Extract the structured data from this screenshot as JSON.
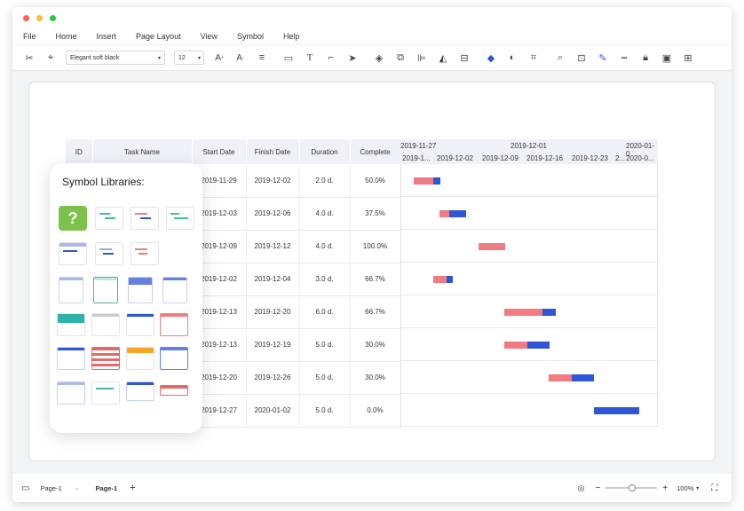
{
  "menu": [
    "File",
    "Home",
    "Insert",
    "Page Layout",
    "View",
    "Symbol",
    "Help"
  ],
  "toolbar": {
    "font_name": "Elegant soft black",
    "font_size": "12"
  },
  "table": {
    "headers": [
      "ID",
      "Task Name",
      "Start Date",
      "Finish Date",
      "Duration",
      "Complete"
    ],
    "rows": [
      {
        "start": "2019-11-29",
        "finish": "2019-12-02",
        "duration": "2.0 d.",
        "complete": "50.0%"
      },
      {
        "start": "2019-12-03",
        "finish": "2019-12-06",
        "duration": "4.0 d.",
        "complete": "37.5%"
      },
      {
        "start": "2019-12-09",
        "finish": "2019-12-12",
        "duration": "4.0 d.",
        "complete": "100.0%"
      },
      {
        "start": "2019-12-02",
        "finish": "2019-12-04",
        "duration": "3.0 d.",
        "complete": "66.7%"
      },
      {
        "start": "2019-12-13",
        "finish": "2019-12-20",
        "duration": "6.0 d.",
        "complete": "66.7%"
      },
      {
        "start": "2019-12-13",
        "finish": "2019-12-19",
        "duration": "5.0 d.",
        "complete": "30.0%"
      },
      {
        "start": "2019-12-20",
        "finish": "2019-12-26",
        "duration": "5.0 d.",
        "complete": "30.0%"
      },
      {
        "start": "2019-12-27",
        "finish": "2020-01-02",
        "duration": "5.0 d.",
        "complete": "0.0%"
      }
    ]
  },
  "timeline": {
    "top_labels": [
      "2019-11-27",
      "2019-12-01",
      "2020-01-0"
    ],
    "bottom_labels": [
      "2019-1...",
      "2019-12-02",
      "2019-12-09",
      "2019-12-16",
      "2019-12-23",
      "2...",
      "2020-0..."
    ]
  },
  "panel": {
    "title": "Symbol Libraries:"
  },
  "status": {
    "page_selector": "Page-1",
    "page_tab": "Page-1",
    "add": "+",
    "zoom": "100%"
  },
  "colors": {
    "done": "#f07c82",
    "remaining": "#2f56d6",
    "header_bg": "#eef1f8"
  }
}
